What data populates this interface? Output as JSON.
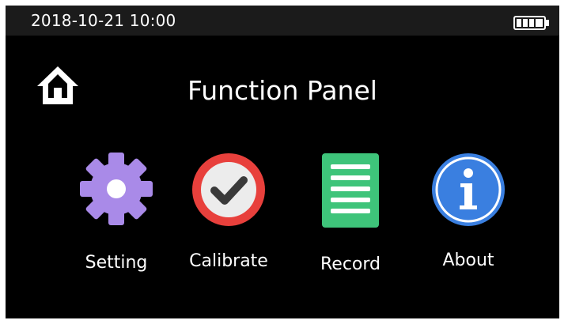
{
  "status_bar": {
    "datetime": "2018-10-21  10:00",
    "battery_icon": "battery-full-icon",
    "battery_level": 1.0
  },
  "header": {
    "home_icon": "home-icon",
    "title": "Function Panel"
  },
  "functions": [
    {
      "label": "Setting",
      "icon": "gear-icon",
      "color": "#a98ae8"
    },
    {
      "label": "Calibrate",
      "icon": "check-circle-icon",
      "color": "#e8403c"
    },
    {
      "label": "Record",
      "icon": "list-icon",
      "color": "#3ec47a"
    },
    {
      "label": "About",
      "icon": "info-icon",
      "color": "#3a7fe0"
    }
  ],
  "colors": {
    "background": "#000000",
    "status_bar": "#1b1b1b",
    "text": "#ffffff"
  }
}
